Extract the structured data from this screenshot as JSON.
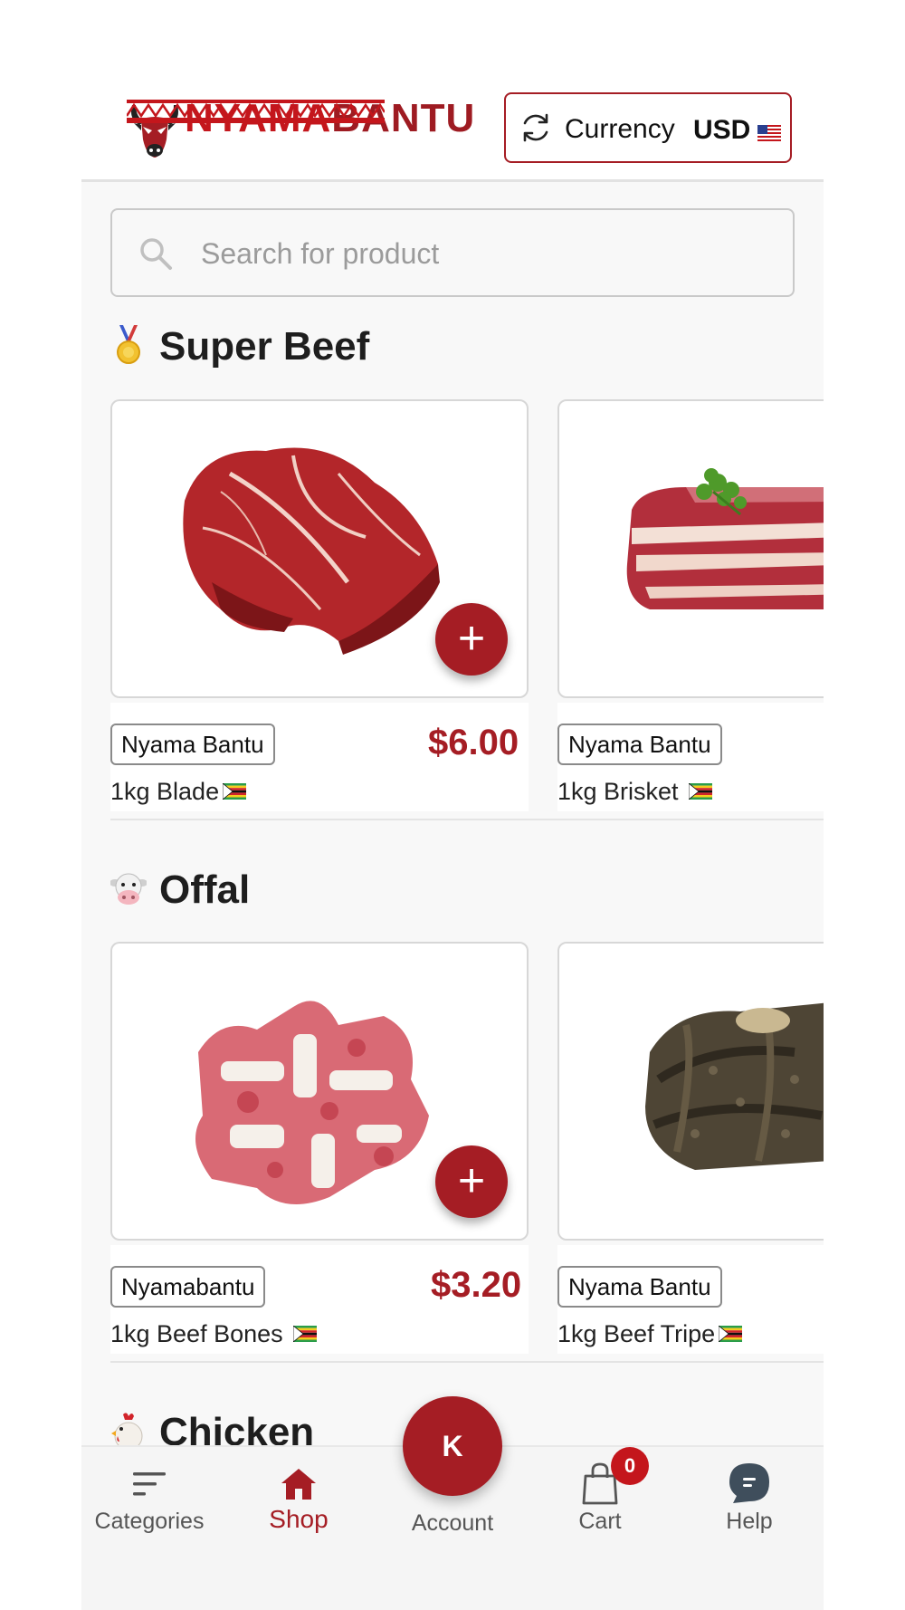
{
  "brand": {
    "name_part1": "NYAMA",
    "name_part2": "BANTU",
    "colors": {
      "primary": "#a51d24",
      "accent": "#c4161c"
    }
  },
  "currency": {
    "label": "Currency",
    "code": "USD",
    "flag": "us-flag-icon"
  },
  "search": {
    "placeholder": "Search for product",
    "value": ""
  },
  "sections": [
    {
      "emoji": "medal-icon",
      "title": "Super Beef",
      "products": [
        {
          "vendor": "Nyama Bantu",
          "price": "$6.00",
          "name": "1kg Blade",
          "flag": "zimbabwe-flag-icon",
          "image": "beef-blade-image"
        },
        {
          "vendor": "Nyama Bantu",
          "price": "",
          "name": "1kg Brisket ",
          "flag": "zimbabwe-flag-icon",
          "image": "beef-brisket-image"
        }
      ]
    },
    {
      "emoji": "cow-face-icon",
      "title": "Offal",
      "products": [
        {
          "vendor": "Nyamabantu",
          "price": "$3.20",
          "name": "1kg Beef Bones ",
          "flag": "zimbabwe-flag-icon",
          "image": "beef-bones-image"
        },
        {
          "vendor": "Nyama Bantu",
          "price": "",
          "name": "1kg Beef Tripe",
          "flag": "zimbabwe-flag-icon",
          "image": "beef-tripe-image"
        }
      ]
    },
    {
      "emoji": "chicken-icon",
      "title": "Chicken",
      "products": []
    }
  ],
  "bottom_nav": {
    "categories": "Categories",
    "shop": "Shop",
    "account": "Account",
    "account_initial": "K",
    "cart": "Cart",
    "cart_count": "0",
    "help": "Help"
  }
}
